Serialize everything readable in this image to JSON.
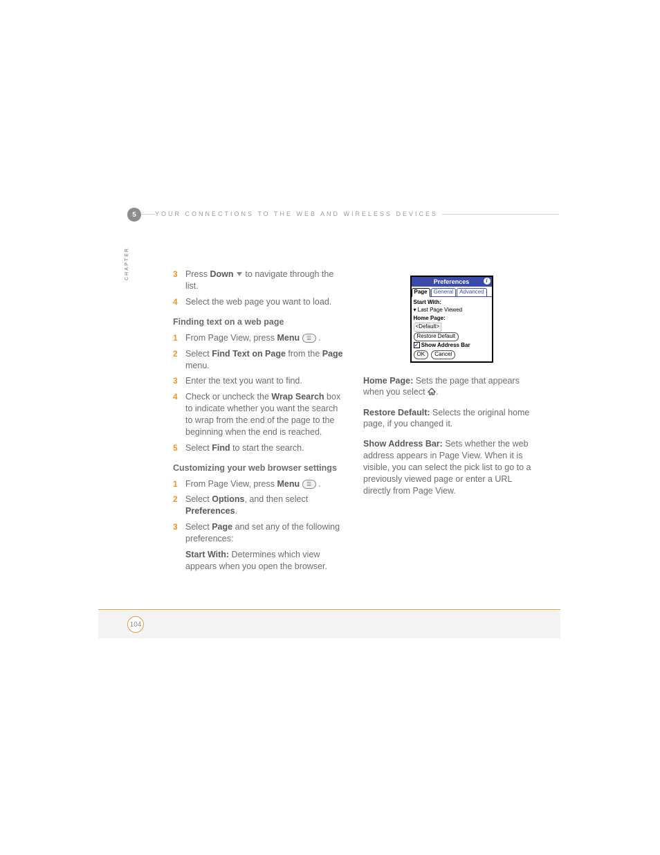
{
  "header": {
    "chapter_num": "5",
    "chapter_label": "CHAPTER",
    "title": "YOUR CONNECTIONS TO THE WEB AND WIRELESS DEVICES"
  },
  "leftCol": {
    "s3": {
      "n": "3",
      "a": "Press ",
      "b": "Down",
      "c": " to navigate through the list."
    },
    "s4": {
      "n": "4",
      "a": "Select the web page you want to load."
    },
    "h1": "Finding text on a web page",
    "f1": {
      "n": "1",
      "a": "From Page View, press ",
      "b": "Menu",
      "c": " ."
    },
    "f2": {
      "n": "2",
      "a": "Select ",
      "b": "Find Text on Page",
      "c": " from the ",
      "d": "Page",
      "e": " menu."
    },
    "f3": {
      "n": "3",
      "a": "Enter the text you want to find."
    },
    "f4": {
      "n": "4",
      "a": "Check or uncheck the ",
      "b": "Wrap Search",
      "c": " box to indicate whether you want the search to wrap from the end of the page to the beginning when the end is reached."
    },
    "f5": {
      "n": "5",
      "a": "Select ",
      "b": "Find",
      "c": " to start the search."
    },
    "h2": "Customizing your web browser settings",
    "c1": {
      "n": "1",
      "a": "From Page View, press ",
      "b": "Menu",
      "c": " ."
    },
    "c2": {
      "n": "2",
      "a": "Select ",
      "b": "Options",
      "c": ", and then select ",
      "d": "Preferences",
      "e": "."
    },
    "c3": {
      "n": "3",
      "a": "Select ",
      "b": "Page",
      "c": " and set any of the following preferences:"
    },
    "sw": {
      "b": "Start With:",
      "t": " Determines which view appears when you open the browser."
    }
  },
  "pref": {
    "title": "Preferences",
    "tabs": {
      "t1": "Page",
      "t2": "General",
      "t3": "Advanced"
    },
    "startWith": "Start With:",
    "startVal": "Last Page Viewed",
    "homePage": "Home Page:",
    "defaultSel": "<Default>",
    "restore": "Restore Default",
    "showAddr": "Show Address Bar",
    "ok": "OK",
    "cancel": "Cancel"
  },
  "rightCol": {
    "hp": {
      "b": "Home Page:",
      "t": " Sets the page that appears when you select "
    },
    "rd": {
      "b": "Restore Default:",
      "t": " Selects the original home page, if you changed it."
    },
    "sa": {
      "b": "Show Address Bar:",
      "t": " Sets whether the web address appears in Page View. When it is visible, you can select the pick list to go to a previously viewed page or enter a URL directly from Page View."
    }
  },
  "footer": {
    "page": "104"
  }
}
